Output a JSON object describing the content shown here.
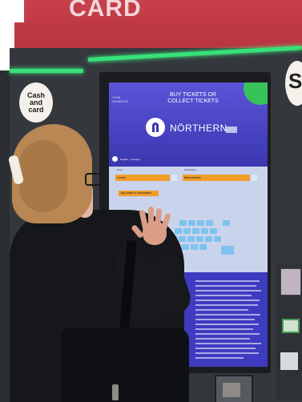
{
  "sign": {
    "text": "CARD"
  },
  "kiosk": {
    "cash_badge": [
      "Cash",
      "and",
      "card"
    ],
    "right_badge": "S"
  },
  "screen": {
    "time": [
      "13:45",
      "22/06/2023"
    ],
    "heading": [
      "BUY TICKETS OR",
      "COLLECT TICKETS"
    ],
    "brand": "NÖRTHERN",
    "language": "English · Cymraeg",
    "from_label": "From",
    "to_label": "Destination",
    "from_value": "Leeds",
    "to_value": "Manchester",
    "chip": "Buy ticket to Manchester"
  },
  "colors": {
    "screen_blue": "#4b46c9",
    "field_orange": "#f29d2a",
    "kiosk_green": "#38e07a",
    "sign_pink": "#c8404c"
  }
}
